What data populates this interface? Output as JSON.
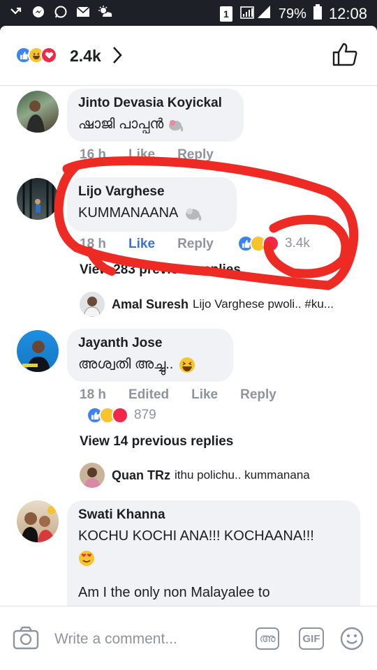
{
  "status_bar": {
    "battery": "79%",
    "time": "12:08",
    "sim_badge": "1"
  },
  "header": {
    "reaction_count": "2.4k"
  },
  "comments": [
    {
      "author": "Jinto Devasia Koyickal",
      "text": "ഷാജി പാപ്പൻ",
      "time": "16 h",
      "like": "Like",
      "reply": "Reply"
    },
    {
      "author": "Lijo Varghese",
      "text": "KUMMANAANA",
      "time": "18 h",
      "like": "Like",
      "reply": "Reply",
      "reactions": "3.4k",
      "view_replies": "View 283 previous replies",
      "latest_reply": {
        "name": "Amal Suresh",
        "text": "Lijo Varghese pwoli.. #ku..."
      }
    },
    {
      "author": "Jayanth Jose",
      "text": "അശ്വതി അച്ചു..",
      "time": "18 h",
      "edited": "Edited",
      "like": "Like",
      "reply": "Reply",
      "reactions": "879",
      "view_replies": "View 14 previous replies",
      "latest_reply": {
        "name": "Quan TRz",
        "text": "ithu polichu.. kummanana"
      }
    },
    {
      "author": "Swati Khanna",
      "text_line1": "KOCHU KOCHI ANA!!! KOCHAANA!!!",
      "text_line2": "Am I the only non Malayalee to"
    }
  ],
  "composer": {
    "placeholder": "Write a comment...",
    "malayalam_key": "അ",
    "gif_label": "GIF"
  },
  "colors": {
    "accent_blue": "#3b72d8",
    "annotation_red": "#ee2a24",
    "bubble_gray": "#f0f2f5"
  }
}
